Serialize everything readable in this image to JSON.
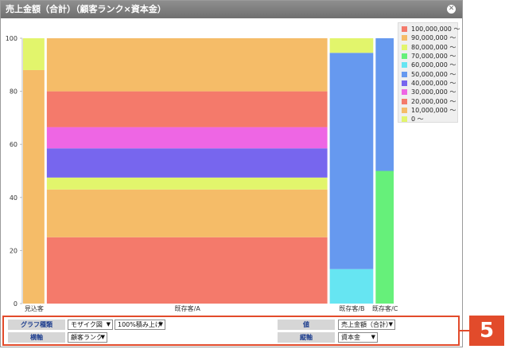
{
  "window": {
    "title": "売上金額（合計）（顧客ランク×資本金）",
    "close_icon": "close-icon"
  },
  "chart_data": {
    "type": "mosaic",
    "mode": "100%積み上げ",
    "ylim": [
      0,
      100
    ],
    "yticks": [
      "0",
      "20",
      "40",
      "60",
      "80",
      "100"
    ],
    "grid": false,
    "legend_position": "right",
    "categories": [
      "見込客",
      "既存客/A",
      "既存客/B",
      "既存客/C"
    ],
    "category_widths": [
      1,
      12.7,
      2,
      0.85
    ],
    "series": [
      {
        "name": "100,000,000 ～",
        "color": "#f47a6b",
        "values": [
          0,
          0,
          0,
          0
        ]
      },
      {
        "name": "90,000,000 ～",
        "color": "#f5bc68",
        "values": [
          0,
          0,
          0,
          0
        ]
      },
      {
        "name": "80,000,000 ～",
        "color": "#e2f56c",
        "values": [
          0,
          0,
          0,
          0
        ]
      },
      {
        "name": "70,000,000 ～",
        "color": "#66f07a",
        "values": [
          0,
          0,
          0,
          50
        ]
      },
      {
        "name": "60,000,000 ～",
        "color": "#66e5f2",
        "values": [
          0,
          0,
          13,
          0
        ]
      },
      {
        "name": "50,000,000 ～",
        "color": "#6699ef",
        "values": [
          0,
          0,
          81.5,
          50
        ]
      },
      {
        "name": "40,000,000 ～",
        "color": "#7766ee",
        "values": [
          0,
          11,
          0,
          0
        ]
      },
      {
        "name": "30,000,000 ～",
        "color": "#ee66e4",
        "values": [
          0,
          8,
          0,
          0
        ]
      },
      {
        "name": "20,000,000 ～",
        "color": "#f47a6b",
        "values": [
          0,
          21,
          0,
          0
        ]
      },
      {
        "name": "10,000,000 ～",
        "color": "#f5bc68",
        "values": [
          88,
          18,
          0,
          0
        ]
      },
      {
        "name": "0 ～",
        "color": "#e2f56c",
        "values": [
          12,
          0,
          5.5,
          0
        ]
      }
    ],
    "stack_order": [
      [
        [
          "10,000,000 ～",
          88
        ],
        [
          "0 ～",
          12
        ]
      ],
      [
        [
          "20,000,000 ～",
          25
        ],
        [
          "10,000,000 ～",
          18
        ],
        [
          "0 ～",
          4.5
        ],
        [
          "40,000,000 ～",
          11
        ],
        [
          "30,000,000 ～",
          8
        ],
        [
          "20,000,000 ～",
          13.5
        ],
        [
          "10,000,000 ～",
          20
        ]
      ],
      [
        [
          "60,000,000 ～",
          13
        ],
        [
          "50,000,000 ～",
          81.5
        ],
        [
          "0 ～",
          5.5
        ]
      ],
      [
        [
          "70,000,000 ～",
          50
        ],
        [
          "50,000,000 ～",
          50
        ]
      ]
    ]
  },
  "controls": {
    "graph_type_label": "グラフ種類",
    "graph_type_value": "モザイク図",
    "stack_mode_value": "100%積み上げ",
    "horizontal_axis_label": "横軸",
    "horizontal_axis_value": "顧客ランク",
    "value_label": "値",
    "value_value": "売上金額（合計）",
    "vertical_axis_label": "縦軸",
    "vertical_axis_value": "資本金"
  },
  "annotation": {
    "badge_number": "5",
    "accent_color": "#e24b2b"
  }
}
